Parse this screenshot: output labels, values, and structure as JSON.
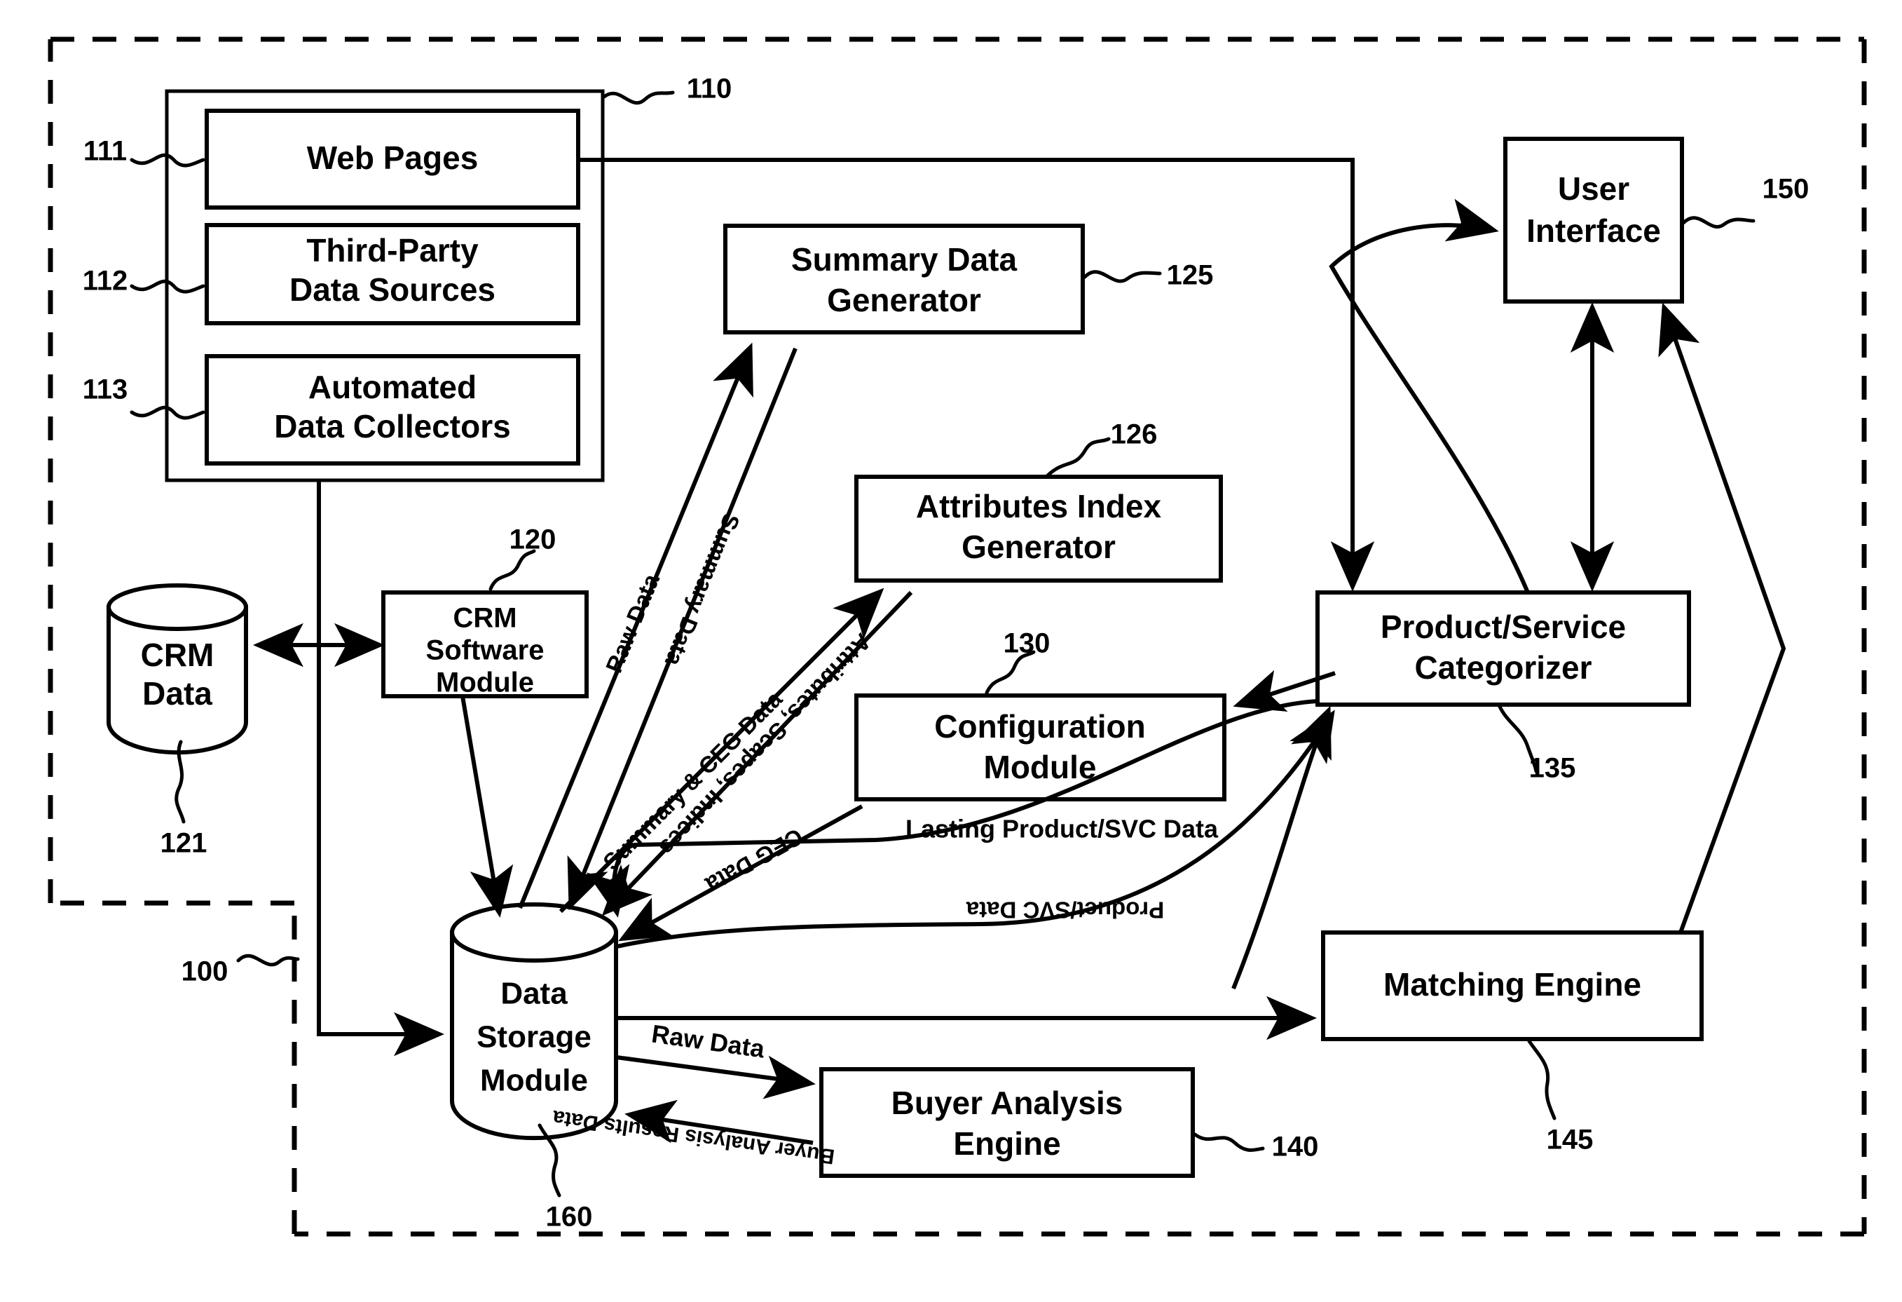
{
  "figure": {
    "type": "patent-block-diagram",
    "background": "#ffffff",
    "ink_color": "#000000"
  },
  "boundaries": {
    "system_ref": "100"
  },
  "data_sources_group": {
    "ref": "110",
    "items": [
      {
        "ref": "111",
        "label_line1": "Web Pages",
        "label_line2": ""
      },
      {
        "ref": "112",
        "label_line1": "Third-Party",
        "label_line2": "Data Sources"
      },
      {
        "ref": "113",
        "label_line1": "Automated",
        "label_line2": "Data Collectors"
      }
    ]
  },
  "nodes": [
    {
      "id": "crm-data",
      "ref": "121",
      "shape": "cylinder",
      "line1": "CRM",
      "line2": "Data",
      "line3": ""
    },
    {
      "id": "crm-software",
      "ref": "120",
      "shape": "box",
      "line1": "CRM",
      "line2": "Software",
      "line3": "Module"
    },
    {
      "id": "summary-data-generator",
      "ref": "125",
      "shape": "box",
      "line1": "Summary Data",
      "line2": "Generator",
      "line3": ""
    },
    {
      "id": "attributes-index-generator",
      "ref": "126",
      "shape": "box",
      "line1": "Attributes Index",
      "line2": "Generator",
      "line3": ""
    },
    {
      "id": "configuration-module",
      "ref": "130",
      "shape": "box",
      "line1": "Configuration",
      "line2": "Module",
      "line3": ""
    },
    {
      "id": "data-storage-module",
      "ref": "160",
      "shape": "cylinder",
      "line1": "Data",
      "line2": "Storage",
      "line3": "Module"
    },
    {
      "id": "buyer-analysis-engine",
      "ref": "140",
      "shape": "box",
      "line1": "Buyer Analysis",
      "line2": "Engine",
      "line3": ""
    },
    {
      "id": "user-interface",
      "ref": "150",
      "shape": "box",
      "line1": "User",
      "line2": "Interface",
      "line3": ""
    },
    {
      "id": "product-service-categorizer",
      "ref": "135",
      "shape": "box",
      "line1": "Product/Service",
      "line2": "Categorizer",
      "line3": ""
    },
    {
      "id": "matching-engine",
      "ref": "145",
      "shape": "box",
      "line1": "Matching Engine",
      "line2": "",
      "line3": ""
    }
  ],
  "flow_labels": {
    "raw_data_diag": "Raw Data",
    "summary_data": "Summary Data",
    "summary_ceg_data": "Summary & CEG Data",
    "attributes_scapes_indices": "Attributes, Scapes, Indices",
    "ceg_data": "CEG Data",
    "lasting_product_svc_data": "Lasting Product/SVC Data",
    "product_svc_data": "Product/SVC Data",
    "raw_data_buyer": "Raw Data",
    "buyer_analysis_results_data": "Buyer Analysis Results Data"
  },
  "reference_numerals": {
    "n100": "100",
    "n110": "110",
    "n111": "111",
    "n112": "112",
    "n113": "113",
    "n120": "120",
    "n121": "121",
    "n125": "125",
    "n126": "126",
    "n130": "130",
    "n135": "135",
    "n140": "140",
    "n145": "145",
    "n150": "150",
    "n160": "160"
  }
}
